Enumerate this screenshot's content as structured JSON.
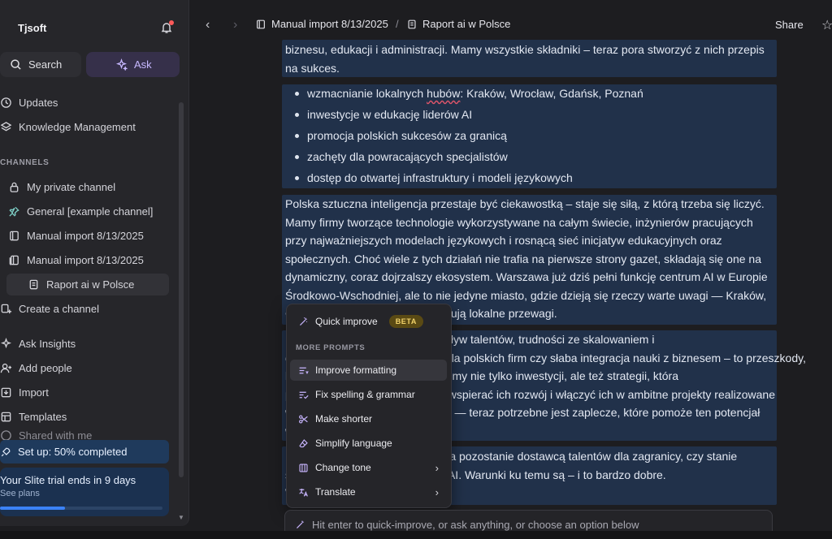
{
  "sidebar": {
    "workspace_name": "Tjsoft",
    "search_label": "Search",
    "ask_label": "Ask",
    "updates_label": "Updates",
    "knowledge_label": "Knowledge Management",
    "channels_header": "CHANNELS",
    "channels": [
      {
        "label": "My private channel",
        "icon": "lock-icon"
      },
      {
        "label": "General [example channel]",
        "icon": "pin-icon"
      },
      {
        "label": "Manual import 8/13/2025",
        "icon": "doc-icon"
      },
      {
        "label": "Manual import 8/13/2025",
        "icon": "docs-icon"
      },
      {
        "label": "Raport ai w Polsce",
        "icon": "page-icon"
      }
    ],
    "create_channel_label": "Create a channel",
    "bottom_items": [
      {
        "label": "Ask Insights",
        "icon": "sparkle-icon"
      },
      {
        "label": "Add people",
        "icon": "add-person-icon"
      },
      {
        "label": "Import",
        "icon": "import-icon"
      },
      {
        "label": "Templates",
        "icon": "templates-icon"
      },
      {
        "label": "Shared with me",
        "icon": "shared-icon"
      }
    ],
    "setup_label": "Set up: 50% completed",
    "trial_title": "Your Slite trial ends in 9 days",
    "trial_sub": "See plans",
    "trial_progress": 0.4
  },
  "header": {
    "crumb_1": "Manual import 8/13/2025",
    "crumb_sep": "/",
    "crumb_2": "Raport ai w Polsce",
    "share_label": "Share"
  },
  "doc": {
    "intro": "biznesu, edukacji i administracji. Mamy wszystkie składniki – teraz pora stworzyć z nich przepis na sukces.",
    "bullets": [
      {
        "pre": "wzmacnianie lokalnych ",
        "mark": "hubów",
        "post": ": Kraków, Wrocław, Gdańsk, Poznań"
      },
      {
        "pre": "inwestycje w edukację liderów AI",
        "mark": "",
        "post": ""
      },
      {
        "pre": "promocja polskich sukcesów za granicą",
        "mark": "",
        "post": ""
      },
      {
        "pre": "zachęty dla powracających specjalistów",
        "mark": "",
        "post": ""
      },
      {
        "pre": "dostęp do otwartej infrastruktury i modeli językowych",
        "mark": "",
        "post": ""
      }
    ],
    "para2": "Polska sztuczna inteligencja przestaje być ciekawostką – staje się siłą, z którą trzeba się liczyć. Mamy firmy tworzące technologie wykorzystywane na całym świecie, inżynierów pracujących przy najważniejszych modelach językowych i rosnącą sieć inicjatyw edukacyjnych oraz społecznych. Choć wiele z tych działań nie trafia na pierwsze strony gazet, składają się one na dynamiczny, coraz dojrzalszy ekosystem. Warszawa już dziś pełni funkcję centrum AI w Europie Środkowo-Wschodniej, ale to nie jedyne miasto, gdzie dzieją się rzeczy warte uwagi — Kraków, Gdańsk czy Poznań również budują lokalne przewagi.",
    "para3_lines": [
      "Nie brakuje jednak wyzwań. Odpływ talentów, trudności ze skalowaniem i",
      "ograniczony dostęp do kapitału dla polskich firm czy słaba integracja nauki z biznesem – to przeszkody,",
      "które trzeba pokonać. Potrzebujemy nie tylko inwestycji, ale też strategii, która",
      "pozwoli zatrzymać specjalistów, wspierać ich rozwój i włączyć ich w ambitne projekty realizowane",
      "w kraju. Mamy ludzi z pomysłami — teraz potrzebne jest zaplecze, które pomoże ten potencjał",
      "w pełni wykorzystać."
    ],
    "para4_lines": [
      "Następne lata pokażą, czy Polska pozostanie dostawcą talentów dla zagranicy, czy stanie",
      "się partnerem w światowej lidze AI. Warunki ku temu są – i to bardzo dobre.",
      "Wystarczy je wykorzystać."
    ]
  },
  "ai_menu": {
    "quick_improve": "Quick improve",
    "beta_badge": "BETA",
    "more_prompts": "MORE PROMPTS",
    "items": [
      {
        "label": "Improve formatting",
        "icon": "format-icon",
        "submenu": false
      },
      {
        "label": "Fix spelling & grammar",
        "icon": "spellcheck-icon",
        "submenu": false
      },
      {
        "label": "Make shorter",
        "icon": "scissors-icon",
        "submenu": false
      },
      {
        "label": "Simplify language",
        "icon": "eraser-icon",
        "submenu": false
      },
      {
        "label": "Change tone",
        "icon": "tone-icon",
        "submenu": true
      },
      {
        "label": "Translate",
        "icon": "translate-icon",
        "submenu": true
      }
    ]
  },
  "prompt": {
    "placeholder": "Hit enter to quick-improve, or ask anything, or choose an option below"
  }
}
